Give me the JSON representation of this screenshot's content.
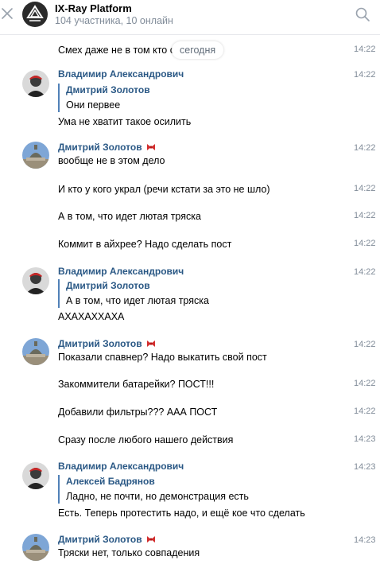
{
  "header": {
    "title": "IX-Ray Platform",
    "subtitle": "104 участника, 10 онлайн"
  },
  "date_divider": "сегодня",
  "messages": [
    {
      "text": "Смех даже не в том кто своровал",
      "time": "14:22"
    },
    {
      "author": "Владимир Александрович",
      "time": "14:22",
      "quote_author": "Дмитрий Золотов",
      "quote_text": "Они первее",
      "text": "Ума не хватит такое осилить"
    },
    {
      "author": "Дмитрий Золотов",
      "time": "14:22",
      "text": "вообще не в этом дело"
    },
    {
      "text": "И кто у кого украл (речи кстати за это не шло)",
      "time": "14:22"
    },
    {
      "text": "А в том, что идет лютая тряска",
      "time": "14:22"
    },
    {
      "text": "Коммит в айхрее? Надо сделать пост",
      "time": "14:22"
    },
    {
      "author": "Владимир Александрович",
      "time": "14:22",
      "quote_author": "Дмитрий Золотов",
      "quote_text": "А в том, что идет лютая тряска",
      "text": "АХАХАХХАХА"
    },
    {
      "author": "Дмитрий Золотов",
      "time": "14:22",
      "text": "Показали спавнер? Надо выкатить свой пост"
    },
    {
      "text": "Закоммители батарейки? ПОСТ!!!",
      "time": "14:22"
    },
    {
      "text": "Добавили фильтры??? ААА ПОСТ",
      "time": "14:22"
    },
    {
      "text": "Сразу после любого нашего действия",
      "time": "14:23"
    },
    {
      "author": "Владимир Александрович",
      "time": "14:23",
      "quote_author": "Алексей Бадрянов",
      "quote_text": "Ладно, не почти, но демонстрация есть",
      "text": "Есть. Теперь протестить надо, и ещё кое что сделать"
    },
    {
      "author": "Дмитрий Золотов",
      "time": "14:23",
      "text": "Тряски нет, только совпадения"
    }
  ]
}
